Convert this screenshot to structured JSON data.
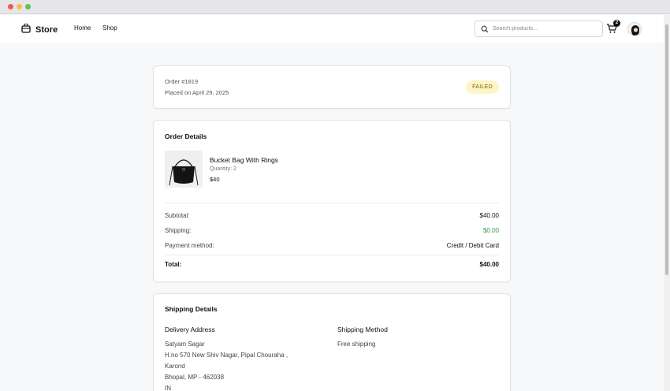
{
  "app": {
    "brand": "Store"
  },
  "nav": {
    "home": "Home",
    "shop": "Shop"
  },
  "search": {
    "placeholder": "Search products...",
    "value": ""
  },
  "cart": {
    "count": "2"
  },
  "order": {
    "number": "Order #1819",
    "placed": "Placed on April 29, 2025",
    "status": "FAILED"
  },
  "details": {
    "title": "Order Details",
    "item": {
      "name": "Bucket Bag With Rings",
      "quantity": "Quantity: 2",
      "price": "$40"
    },
    "subtotal_label": "Subtotal:",
    "subtotal": "$40.00",
    "shipping_label": "Shipping:",
    "shipping": "$0.00",
    "payment_label": "Payment method:",
    "payment": "Credit / Debit Card",
    "total_label": "Total:",
    "total": "$40.00"
  },
  "shipping_details": {
    "title": "Shipping Details",
    "address_title": "Delivery Address",
    "address_lines": [
      "Satyam Sagar",
      "H.no 570 New Shiv Nagar, Pipal Chouraha ,",
      "Karond",
      "Bhopal, MP - 462038",
      "IN"
    ],
    "method_title": "Shipping Method",
    "method": "Free shipping"
  },
  "colors": {
    "accent": "#111111",
    "status_bg": "#fdf5c7",
    "shipping_green": "#2e9c4a"
  },
  "icons": [
    "shopping-bag-icon",
    "search-icon",
    "cart-icon",
    "avatar"
  ]
}
